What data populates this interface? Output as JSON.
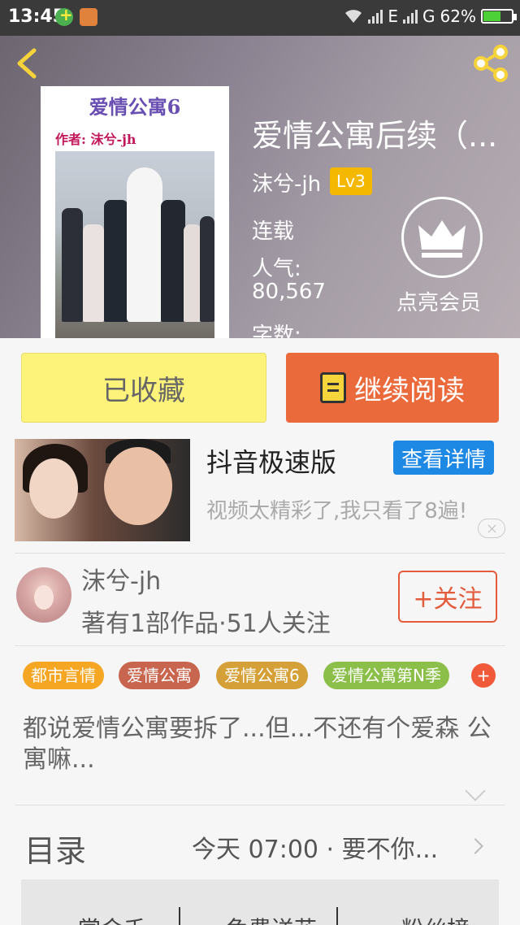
{
  "status_bar": {
    "time": "13:45",
    "network_1": "E",
    "network_2": "G",
    "battery": "62%",
    "battery_level": 0.62
  },
  "header": {
    "cover": {
      "title": "爱情公寓6",
      "author_line": "作者: 沫兮-jh"
    },
    "title": "爱情公寓后续（...",
    "author": "沫兮-jh",
    "level": "Lv3",
    "status": "连载",
    "popularity_label": "人气:",
    "popularity_value": "80,567",
    "wordcount_label": "字数:",
    "vip_label": "点亮会员"
  },
  "actions": {
    "collected_label": "已收藏",
    "continue_label": "继续阅读"
  },
  "ad": {
    "title": "抖音极速版",
    "detail_button": "查看详情",
    "description": "视频太精彩了,我只看了8遍!"
  },
  "author_block": {
    "name": "沫兮-jh",
    "stats": "著有1部作品·51人关注",
    "follow_button": "+关注"
  },
  "tags": [
    {
      "label": "都市言情",
      "color": "#f5a623"
    },
    {
      "label": "爱情公寓",
      "color": "#c8654f"
    },
    {
      "label": "爱情公寓6",
      "color": "#d4a037"
    },
    {
      "label": "爱情公寓第N季",
      "color": "#8bbf4a"
    }
  ],
  "tag_more": "+",
  "intro": "都说爱情公寓要拆了...但...不还有个爱森 公寓嘛...",
  "toc": {
    "label": "目录",
    "latest": "今天 07:00 · 要不你..."
  },
  "bottom_tabs": [
    "赏金千",
    "免费送花",
    "粉丝榜"
  ],
  "colors": {
    "accent_orange": "#ea6a3b",
    "collected_yellow": "#fdf27a",
    "detail_blue": "#1e88e5",
    "level_gold": "#f5b800"
  }
}
